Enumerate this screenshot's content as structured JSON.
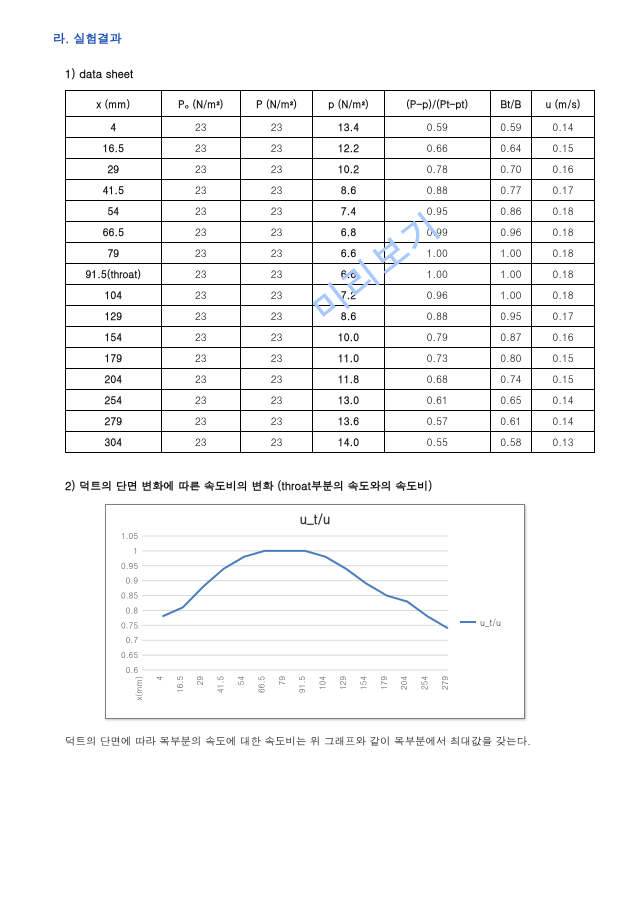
{
  "section_heading": "라. 실험결과",
  "watermark": "미리보기",
  "table_section": {
    "heading": "1) data sheet",
    "columns": [
      "x (mm)",
      "P₀ (N/m²)",
      "P (N/m²)",
      "p (N/m²)",
      "(P-p)/(Pt-pt)",
      "Bt/B",
      "u (m/s)"
    ],
    "rows": [
      {
        "x": "4",
        "p0": "23",
        "P": "23",
        "p": "13.4",
        "ratio": "0.59",
        "bb": "0.59",
        "u": "0.14"
      },
      {
        "x": "16.5",
        "p0": "23",
        "P": "23",
        "p": "12.2",
        "ratio": "0.66",
        "bb": "0.64",
        "u": "0.15"
      },
      {
        "x": "29",
        "p0": "23",
        "P": "23",
        "p": "10.2",
        "ratio": "0.78",
        "bb": "0.70",
        "u": "0.16"
      },
      {
        "x": "41.5",
        "p0": "23",
        "P": "23",
        "p": "8.6",
        "ratio": "0.88",
        "bb": "0.77",
        "u": "0.17"
      },
      {
        "x": "54",
        "p0": "23",
        "P": "23",
        "p": "7.4",
        "ratio": "0.95",
        "bb": "0.86",
        "u": "0.18"
      },
      {
        "x": "66.5",
        "p0": "23",
        "P": "23",
        "p": "6.8",
        "ratio": "0.99",
        "bb": "0.96",
        "u": "0.18"
      },
      {
        "x": "79",
        "p0": "23",
        "P": "23",
        "p": "6.6",
        "ratio": "1.00",
        "bb": "1.00",
        "u": "0.18"
      },
      {
        "x": "91.5(throat)",
        "p0": "23",
        "P": "23",
        "p": "6.6",
        "ratio": "1.00",
        "bb": "1.00",
        "u": "0.18"
      },
      {
        "x": "104",
        "p0": "23",
        "P": "23",
        "p": "7.2",
        "ratio": "0.96",
        "bb": "1.00",
        "u": "0.18"
      },
      {
        "x": "129",
        "p0": "23",
        "P": "23",
        "p": "8.6",
        "ratio": "0.88",
        "bb": "0.95",
        "u": "0.17"
      },
      {
        "x": "154",
        "p0": "23",
        "P": "23",
        "p": "10.0",
        "ratio": "0.79",
        "bb": "0.87",
        "u": "0.16"
      },
      {
        "x": "179",
        "p0": "23",
        "P": "23",
        "p": "11.0",
        "ratio": "0.73",
        "bb": "0.80",
        "u": "0.15"
      },
      {
        "x": "204",
        "p0": "23",
        "P": "23",
        "p": "11.8",
        "ratio": "0.68",
        "bb": "0.74",
        "u": "0.15"
      },
      {
        "x": "254",
        "p0": "23",
        "P": "23",
        "p": "13.0",
        "ratio": "0.61",
        "bb": "0.65",
        "u": "0.14"
      },
      {
        "x": "279",
        "p0": "23",
        "P": "23",
        "p": "13.6",
        "ratio": "0.57",
        "bb": "0.61",
        "u": "0.14"
      },
      {
        "x": "304",
        "p0": "23",
        "P": "23",
        "p": "14.0",
        "ratio": "0.55",
        "bb": "0.58",
        "u": "0.13"
      }
    ]
  },
  "chart_section": {
    "heading": "2) 덕트의 단면 변화에 따른 속도비의 변화 (throat부분의 속도와의 속도비)",
    "caption": "덕트의 단면에 따라 목부분의 속도에 대한 속도비는 위 그래프와 같이 목부분에서 최대값을 갖는다."
  },
  "chart_data": {
    "type": "line",
    "title": "u_t/u",
    "xlabel": "x(mm)",
    "ylabel": "",
    "ylim": [
      0.6,
      1.05
    ],
    "ytick": [
      0.6,
      0.65,
      0.7,
      0.75,
      0.8,
      0.85,
      0.9,
      0.95,
      1,
      1.05
    ],
    "categories": [
      "x(mm)",
      "4",
      "16.5",
      "29",
      "41.5",
      "54",
      "66.5",
      "79",
      "91.5",
      "104",
      "129",
      "154",
      "179",
      "204",
      "254",
      "279"
    ],
    "series": [
      {
        "name": "u_t/u",
        "values": [
          null,
          0.78,
          0.81,
          0.88,
          0.94,
          0.98,
          1.0,
          1.0,
          1.0,
          0.98,
          0.94,
          0.89,
          0.85,
          0.83,
          0.78,
          0.74
        ]
      }
    ]
  }
}
